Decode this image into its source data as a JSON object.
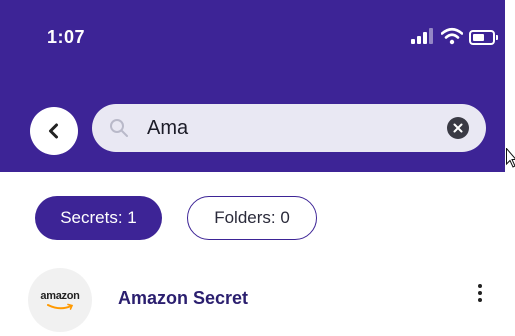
{
  "status_bar": {
    "time": "1:07",
    "icons": [
      "signal-icon",
      "wifi-icon",
      "battery-icon"
    ],
    "battery_level": 0.6
  },
  "search": {
    "value": "Ama",
    "icons": {
      "back": "chevron-left-icon",
      "search": "search-icon",
      "clear": "clear-icon"
    }
  },
  "filters": {
    "secrets_label": "Secrets: 1",
    "folders_label": "Folders: 0",
    "selected": "secrets"
  },
  "results": [
    {
      "title": "Amazon Secret",
      "logo_text": "amazon",
      "icon": "amazon-logo-icon",
      "menu_icon": "more-vertical-icon"
    }
  ],
  "colors": {
    "primary": "#3d2496",
    "search_bg": "#e9e8f3",
    "title_text": "#2b1f6f",
    "amazon_orange": "#ff9900"
  }
}
